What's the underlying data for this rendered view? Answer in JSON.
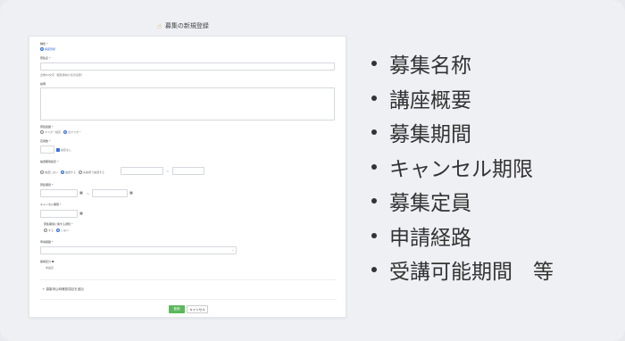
{
  "panel": {
    "title": "募集の新規登録",
    "form": {
      "type_label": "種別 *",
      "type_value": "講座登録",
      "name_label": "募集名 *",
      "name_hint": "全角64文字（閲覧者向け表示名称）",
      "desc_label": "説明",
      "target_label": "募集範囲 *",
      "target_opt1": "マスター指定",
      "target_opt2": "全マスター",
      "capacity_label": "定員数 *",
      "capacity_check": "指定なし",
      "lottery_label": "抽選期間指定 *",
      "lottery_opt1": "抽選しない",
      "lottery_opt2": "抽選する",
      "lottery_opt3": "先着順で抽選する",
      "range_sep": "〜",
      "period_label": "募集期間 *",
      "cancel_label": "キャンセル期限 *",
      "notify_label": "募集期間に関する通知 *",
      "notify_opt1": "する",
      "notify_opt2": "しない",
      "route_label": "申請経路 *",
      "category_label": "開催区分 ❶",
      "category_value": "未設定",
      "add_item": "＋ 募集申込時確認項目を追加",
      "register_button": "登録",
      "cancel_button": "キャンセル"
    }
  },
  "bullets": [
    "募集名称",
    "講座概要",
    "募集期間",
    "キャンセル期限",
    "募集定員",
    "申請経路",
    "受講可能期間　等"
  ]
}
